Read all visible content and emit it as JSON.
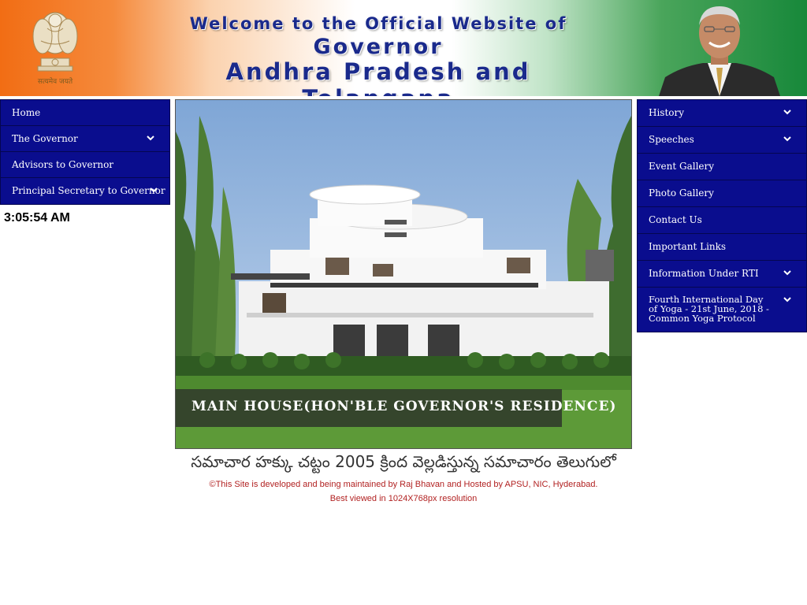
{
  "banner": {
    "line1": "Welcome to the Official Website of",
    "line2": "Governor",
    "line3": "Andhra Pradesh and Telangana",
    "emblem_motto": "सत्यमेव जयते"
  },
  "left_nav": {
    "items": [
      {
        "label": "Home",
        "has_submenu": false
      },
      {
        "label": "The Governor",
        "has_submenu": true
      },
      {
        "label": "Advisors to Governor",
        "has_submenu": false
      },
      {
        "label": "Principal Secretary to Governor",
        "has_submenu": true
      }
    ]
  },
  "clock": "3:05:54 AM",
  "hero": {
    "caption": "MAIN HOUSE(HON'BLE GOVERNOR'S RESIDENCE)"
  },
  "telugu_notice": "సమాచార హక్కు చట్టం 2005 క్రింద వెల్లడిస్తున్న సమాచారం తెలుగులో",
  "footer": {
    "line1": "©This Site is developed and being maintained by Raj Bhavan and Hosted by APSU, NIC, Hyderabad.",
    "line2": "Best viewed in 1024X768px resolution"
  },
  "right_nav": {
    "items": [
      {
        "label": "History",
        "has_submenu": true
      },
      {
        "label": "Speeches",
        "has_submenu": true
      },
      {
        "label": "Event Gallery",
        "has_submenu": false
      },
      {
        "label": "Photo Gallery",
        "has_submenu": false
      },
      {
        "label": "Contact Us",
        "has_submenu": false
      },
      {
        "label": "Important Links",
        "has_submenu": false
      },
      {
        "label": "Information Under RTI",
        "has_submenu": true
      },
      {
        "label": "Fourth International Day of Yoga - 21st June, 2018 - Common Yoga Protocol",
        "has_submenu": true
      }
    ]
  },
  "colors": {
    "nav_bg": "#0a0d8e",
    "banner_title": "#1a2a8c",
    "footer_text": "#b22222",
    "saffron": "#f26d14",
    "green": "#17883a"
  }
}
